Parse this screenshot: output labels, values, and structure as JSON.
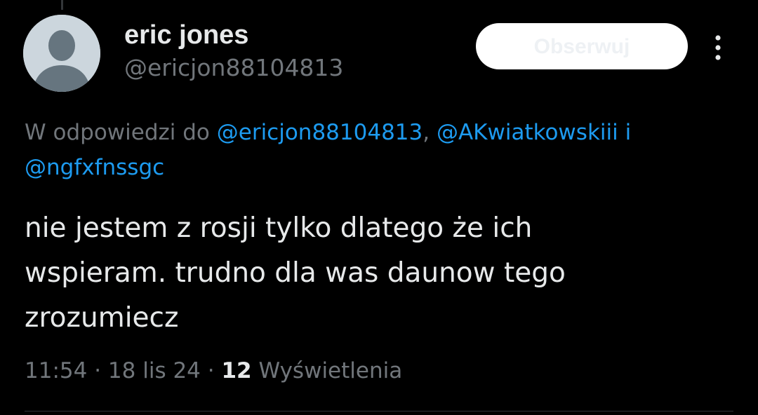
{
  "author": {
    "display_name": "eric jones",
    "handle": "@ericjon88104813",
    "avatar_icon": "default-person-icon"
  },
  "actions": {
    "follow_label": "Obserwuj",
    "more_icon": "more-vertical-icon"
  },
  "reply_context": {
    "prefix": "W odpowiedzi do ",
    "mention_1": "@ericjon88104813",
    "separator": ", ",
    "mention_2": "@AKwiatkowskiii",
    "conjunction": " i ",
    "mention_3": "@ngfxfnssgc"
  },
  "tweet": {
    "lines": [
      "nie jestem z rosji tylko dlatego że ich",
      "wspieram. trudno dla was daunow tego",
      "zrozumiecz"
    ]
  },
  "meta": {
    "time": "11:54",
    "date": "18 lis 24",
    "views_count": "12",
    "views_label": "Wyświetlenia",
    "dot": "·"
  },
  "colors": {
    "background": "#000000",
    "text": "#e7e9ea",
    "secondary": "#71767b",
    "link": "#1d9bf0",
    "button_bg": "#ffffff"
  }
}
